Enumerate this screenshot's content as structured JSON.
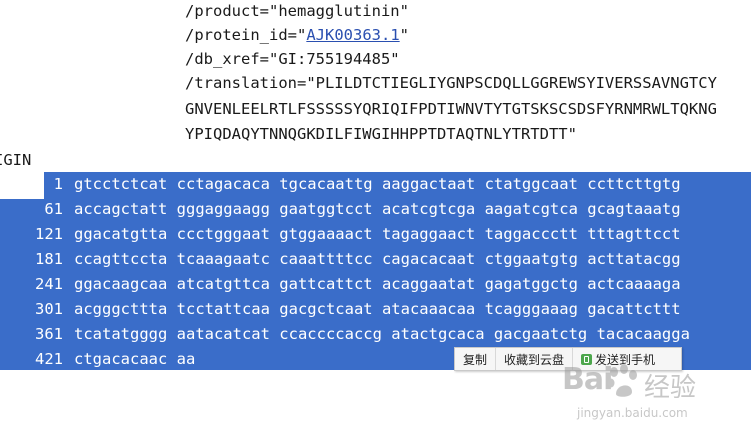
{
  "feature": {
    "line1": "/product=\"hemagglutinin\"",
    "line2_prefix": "/protein_id=\"",
    "line2_link": "AJK00363.1",
    "line2_suffix": "\"",
    "line3": "/db_xref=\"GI:755194485\"",
    "line4": "/translation=\"PLILDTCTIEGLIYGNPSCDQLLGGREWSYIVERSSAVNGTCY",
    "line5": "GNVENLEELRTLFSSSSSYQRIQIFPDTIWNVTYTGTSKSCSDSFYRNMRWLTQKNG",
    "line6": "YPIQDAQYTNNQGKDILFIWGIHHPPTDTAQTNLYTRTDTT\""
  },
  "origin_label": "IGIN",
  "sequence": [
    {
      "num": "1",
      "text": "gtcctctcat cctagacaca tgcacaattg aaggactaat ctatggcaat ccttcttgtg"
    },
    {
      "num": "61",
      "text": "accagctatt gggaggaagg gaatggtcct acatcgtcga aagatcgtca gcagtaaatg"
    },
    {
      "num": "121",
      "text": "ggacatgtta ccctgggaat gtggaaaact tagaggaact taggaccctt tttagttcct"
    },
    {
      "num": "181",
      "text": "ccagttccta tcaaagaatc caaattttcc cagacacaat ctggaatgtg acttatacgg"
    },
    {
      "num": "241",
      "text": "ggacaagcaa atcatgttca gattcattct acaggaatat gagatggctg actcaaaaga"
    },
    {
      "num": "301",
      "text": "acgggcttta tcctattcaa gacgctcaat atacaaacaa tcagggaaag gacattcttt"
    },
    {
      "num": "361",
      "text": "tcatatgggg aatacatcat ccaccccaccg atactgcaca gacgaatctg tacacaagga"
    },
    {
      "num": "421",
      "text": "ctgacacaac aa"
    }
  ],
  "context_menu": {
    "copy": "复制",
    "save_cloud": "收藏到云盘",
    "send_phone": "发送到手机"
  },
  "watermark": {
    "logo": "Bai",
    "text": "经验",
    "url": "jingyan.baidu.com"
  },
  "colors": {
    "selection": "#3a6dc9",
    "link": "#2a4fb0"
  }
}
